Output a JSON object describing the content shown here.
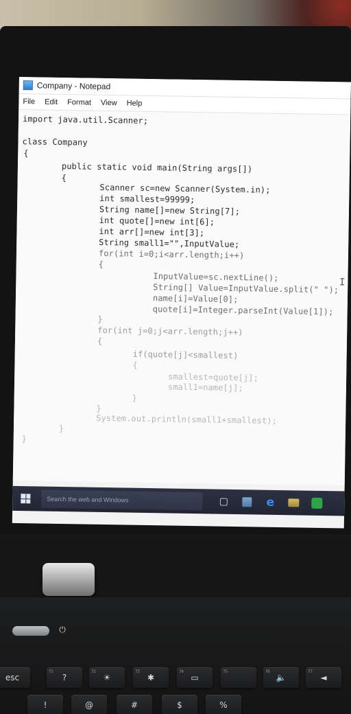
{
  "window": {
    "title": "Company - Notepad",
    "menu": [
      "File",
      "Edit",
      "Format",
      "View",
      "Help"
    ]
  },
  "code_lines": [
    "import java.util.Scanner;",
    "class Company",
    "{",
    "public static void main(String args[])",
    "{",
    "Scanner sc=new Scanner(System.in);",
    "int smallest=99999;",
    "String name[]=new String[7];",
    "int quote[]=new int[6];",
    "int arr[]=new int[3];",
    "String small1=\"\",InputValue;",
    "for(int i=0;i<arr.length;i++)",
    "{",
    "InputValue=sc.nextLine();",
    "String[] Value=InputValue.split(\" \");",
    "name[i]=Value[0];",
    "quote[i]=Integer.parseInt(Value[1]);",
    "}",
    "for(int j=0;j<arr.length;j++)",
    "{",
    "if(quote[j]<smallest)",
    "{",
    "smallest=quote[j];",
    "small1=name[j];",
    "}",
    "}",
    "System.out.println(small1+smallest);",
    "}",
    "}"
  ],
  "taskbar": {
    "search_placeholder": "Search the web and Windows"
  },
  "keyboard": {
    "keys": [
      {
        "label": "esc",
        "sub": ""
      },
      {
        "label": "?",
        "sub": "f1"
      },
      {
        "label": "☀",
        "sub": "f2"
      },
      {
        "label": "✱",
        "sub": "f3"
      },
      {
        "label": "▭",
        "sub": "f4"
      },
      {
        "label": "",
        "sub": "f5"
      },
      {
        "label": "🔈",
        "sub": "f6"
      },
      {
        "label": "◄",
        "sub": "f7"
      }
    ],
    "number_row": [
      "!",
      "@",
      "#",
      "$",
      "%"
    ]
  }
}
